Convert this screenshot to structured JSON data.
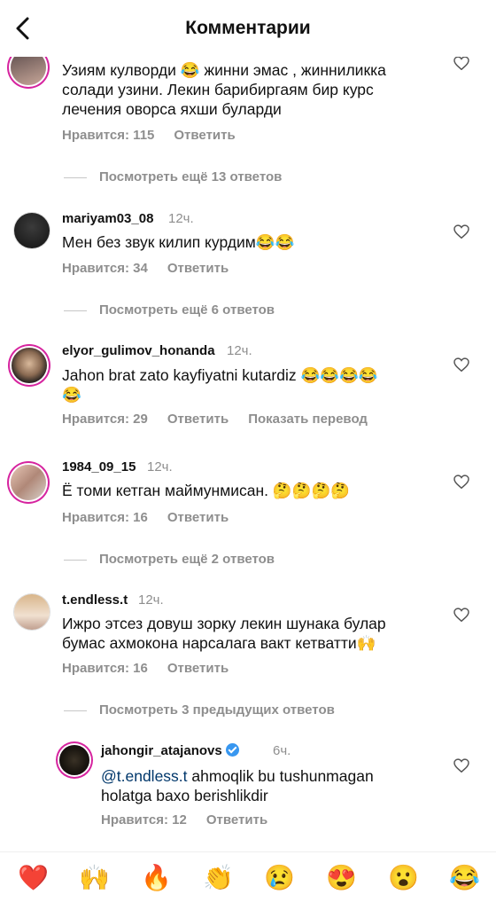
{
  "header": {
    "title": "Комментарии"
  },
  "comments": [
    {
      "username": "",
      "time": "",
      "text": "Узиям кулворди 😂 жинни эмас , жиннилликка соладиузини. Лекин барибиргаям бир курс лечения оворса яхши буларди",
      "text_lines": [
        "Узиям кулворди 😂 жинни эмас , жинниликка",
        "солади узини. Лекин барибиргаям бир курс",
        "лечения оворса яхши буларди"
      ],
      "likes": "Нравится: 115",
      "reply": "Ответить",
      "view_more": "Посмотреть ещё 13 ответов"
    },
    {
      "username": "mariyam03_08",
      "time": "12ч.",
      "text_lines": [
        "Мен без звук килип курдим😂😂"
      ],
      "likes": "Нравится: 34",
      "reply": "Ответить",
      "view_more": "Посмотреть ещё 6 ответов"
    },
    {
      "username": "elyor_gulimov_honanda",
      "time": "12ч.",
      "text_lines": [
        "Jahon brat zato kayfiyatni kutardiz 😂😂😂😂",
        "😂"
      ],
      "likes": "Нравится: 29",
      "reply": "Ответить",
      "translate": "Показать перевод"
    },
    {
      "username": "1984_09_15",
      "time": "12ч.",
      "text_lines": [
        "Ё томи кетган маймунмисан. 🤔🤔🤔🤔"
      ],
      "likes": "Нравится: 16",
      "reply": "Ответить",
      "view_more": "Посмотреть ещё 2 ответов"
    },
    {
      "username": "t.endless.t",
      "time": "12ч.",
      "text_lines": [
        "Ижро этсез довуш зорку лекин шунака булар",
        "бумас ахмокона нарсалага вакт кетватти🙌"
      ],
      "likes": "Нравится: 16",
      "reply": "Ответить",
      "view_more": "Посмотреть 3 предыдущих ответов"
    }
  ],
  "reply_comment": {
    "username": "jahongir_atajanovs",
    "time": "6ч.",
    "mention": "@t.endless.t",
    "text_line1": " ahmoqlik bu tushunmagan",
    "text_line2": "holatga baxo berishlikdir",
    "likes": "Нравится: 12",
    "reply": "Ответить"
  },
  "emoji_bar": [
    "❤️",
    "🙌",
    "🔥",
    "👏",
    "😢",
    "😍",
    "😮",
    "😂"
  ]
}
